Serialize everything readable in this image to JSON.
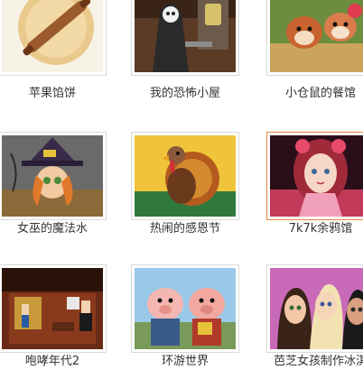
{
  "games": [
    {
      "title": "苹果馅饼",
      "thumb_icon": "rolling-pin-icon"
    },
    {
      "title": "我的恐怖小屋",
      "thumb_icon": "grim-reaper-icon"
    },
    {
      "title": "小仓鼠的餐馆",
      "thumb_icon": "hamster-icon"
    },
    {
      "title": "女巫的魔法水",
      "thumb_icon": "witch-icon"
    },
    {
      "title": "热闹的感恩节",
      "thumb_icon": "turkey-icon"
    },
    {
      "title": "7k7k余鸦馆",
      "thumb_icon": "doll-girl-icon"
    },
    {
      "title": "咆哮年代2",
      "thumb_icon": "pixel-room-icon"
    },
    {
      "title": "环游世界",
      "thumb_icon": "pigs-icon"
    },
    {
      "title": "芭芝女孩制作冰淇",
      "thumb_icon": "bratz-girls-icon"
    }
  ],
  "selected_index": 5,
  "colors": {
    "selected_border": "#e8853c",
    "thumb_border": "#d9d9d9"
  }
}
